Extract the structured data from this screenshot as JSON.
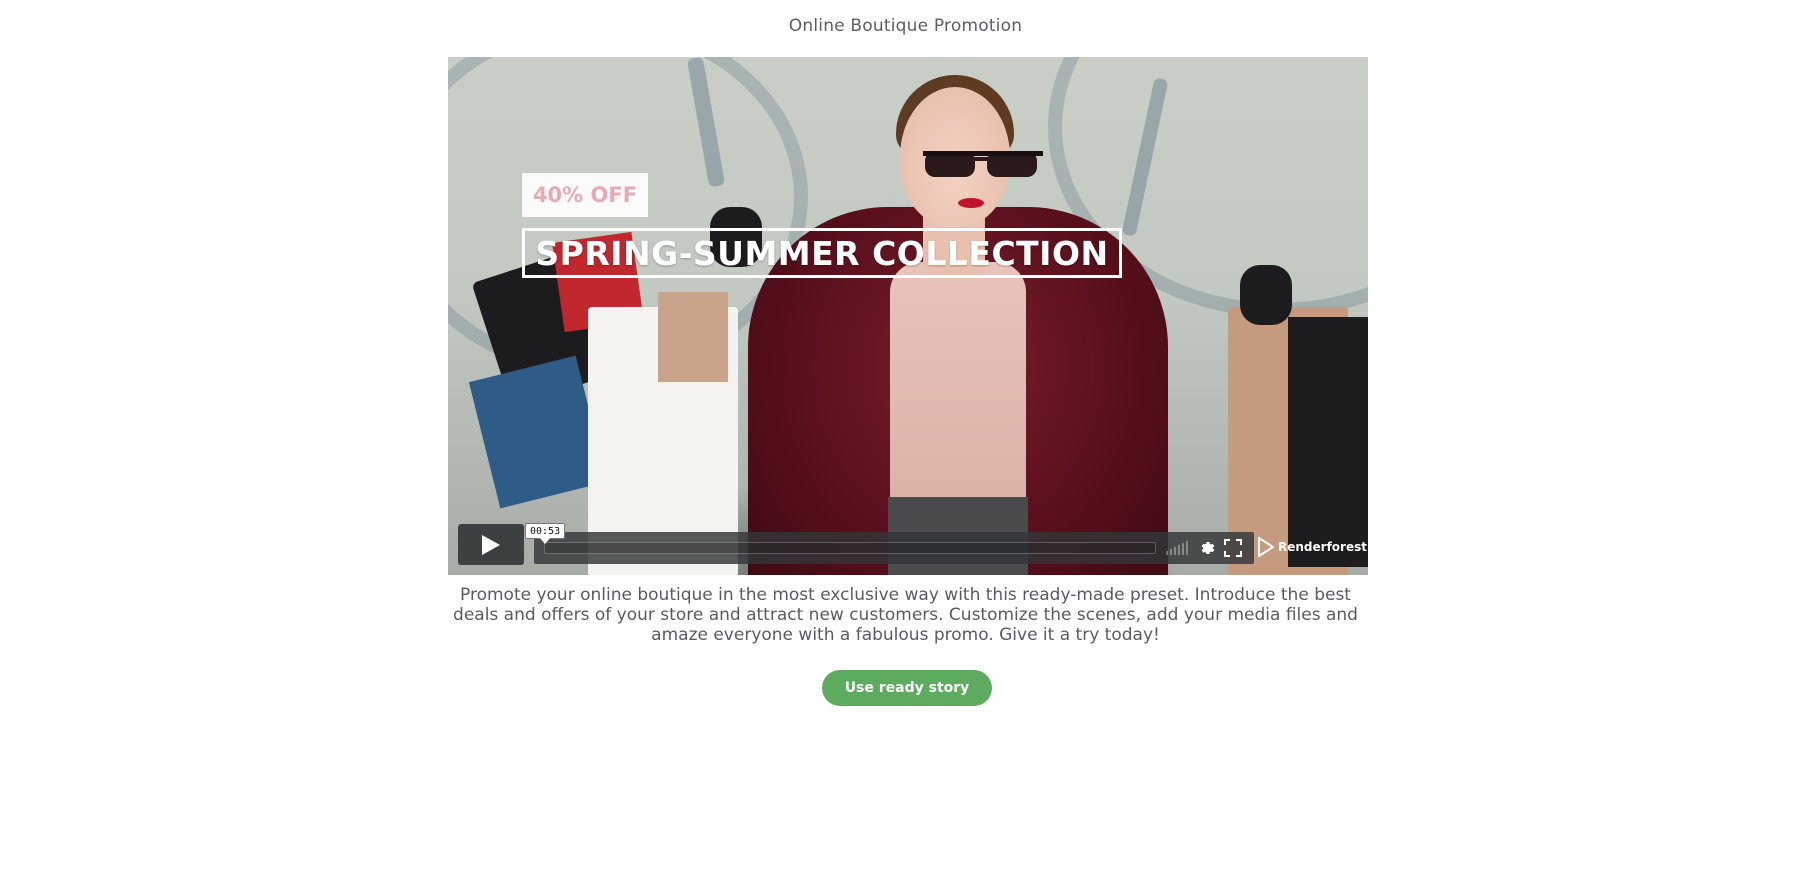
{
  "page": {
    "title": "Online Boutique Promotion"
  },
  "video": {
    "promo_tag": "40% OFF",
    "headline": "SPRING-SUMMER COLLECTION",
    "timestamp": "00:53",
    "progress_fraction": 0.0,
    "brand": "Renderforest",
    "controls": {
      "play_icon": "play-icon",
      "volume_icon": "volume-bars-icon",
      "settings_icon": "gear-icon",
      "fullscreen_icon": "fullscreen-icon",
      "brand_icon": "renderforest-logo-icon"
    }
  },
  "description": "Promote your online boutique in the most exclusive way with this ready-made preset. Introduce the best deals and offers of your store and attract new customers. Customize the scenes, add your media files and amaze everyone with a fabulous promo. Give it a try today!",
  "cta": {
    "label": "Use ready story",
    "color": "#5cab5e"
  }
}
